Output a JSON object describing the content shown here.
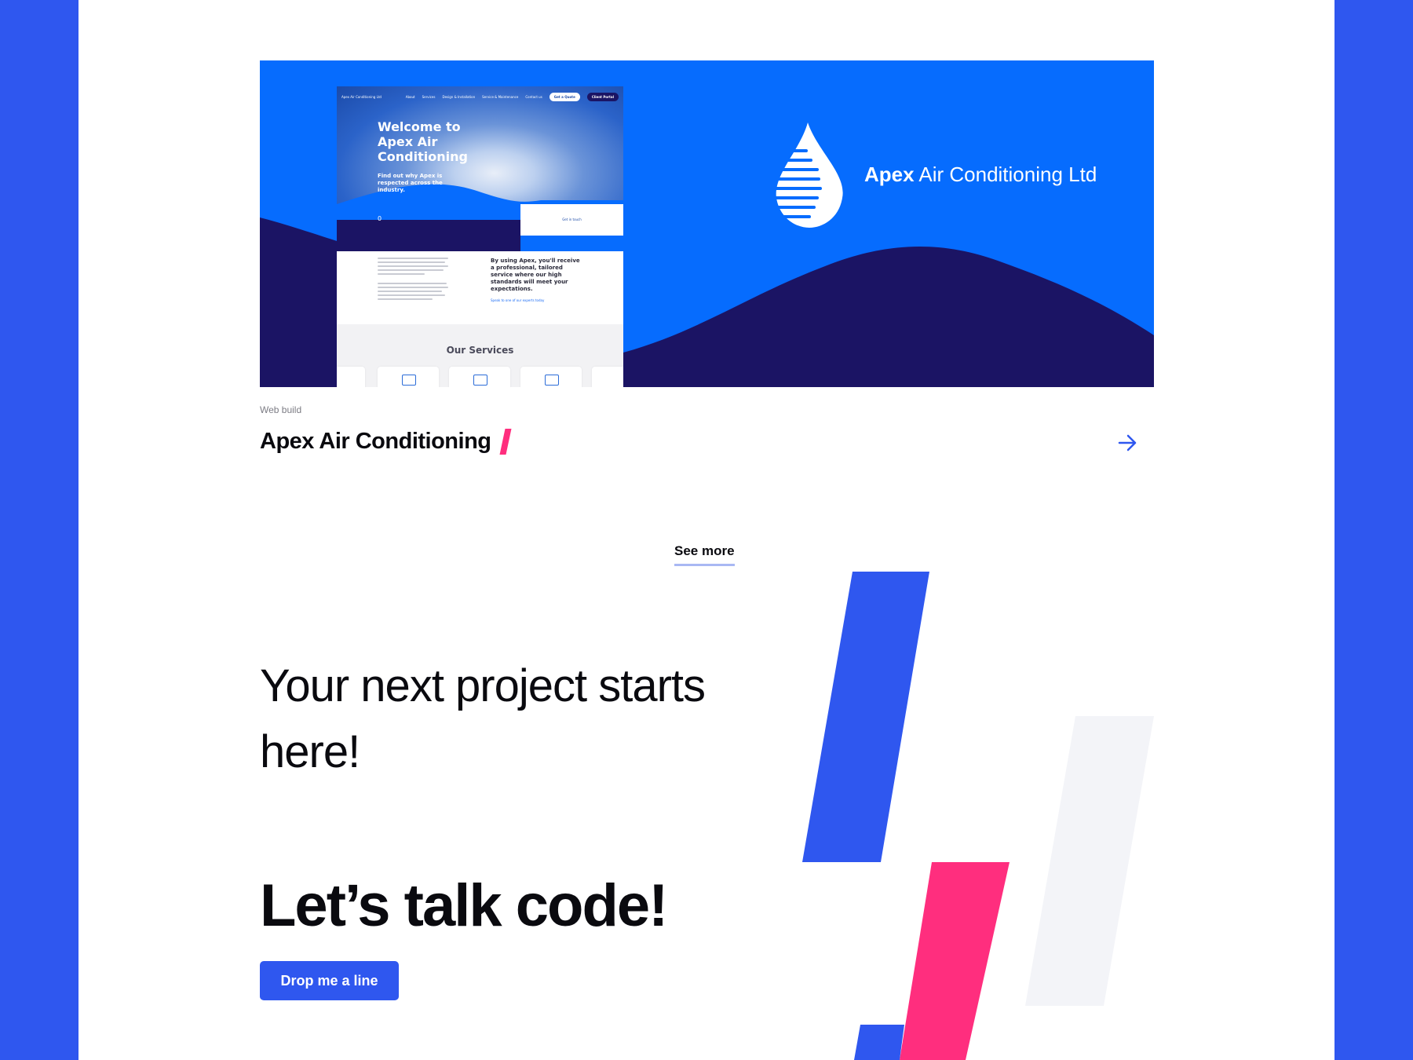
{
  "project": {
    "category": "Web build",
    "title": "Apex Air Conditioning",
    "brand_bold": "Apex",
    "brand_rest": " Air Conditioning Ltd",
    "mockup": {
      "nav_logo": "Apex Air Conditioning Ltd",
      "nav_items": [
        "About",
        "Services",
        "Design & Installation",
        "Service & Maintenance",
        "Contact us"
      ],
      "nav_button_light": "Get a Quote",
      "nav_button_dark": "Client Portal",
      "hero_title": "Welcome to Apex Air Conditioning",
      "hero_subtitle": "Find out why Apex is respected across the industry.",
      "hero_counter": "0",
      "get_in_touch": "Get in touch",
      "body_heading": "By using Apex, you'll receive a professional, tailored service where our high standards will meet your expectations.",
      "body_link": "Speak to one of our experts today",
      "services_title": "Our Services"
    }
  },
  "see_more": "See more",
  "cta": {
    "headline": "Your next project starts here!",
    "tagline": "Let’s talk code!",
    "button": "Drop me a line"
  },
  "colors": {
    "page_bg": "#2f57ef",
    "card_blue": "#066cfe",
    "card_navy": "#1b1464",
    "accent_pink": "#ff2e7e",
    "accent_blue": "#2f57ef",
    "light_grey": "#f3f4f8"
  },
  "icons": {
    "arrow": "arrow-right-icon",
    "logo": "water-drop-logo-icon"
  }
}
